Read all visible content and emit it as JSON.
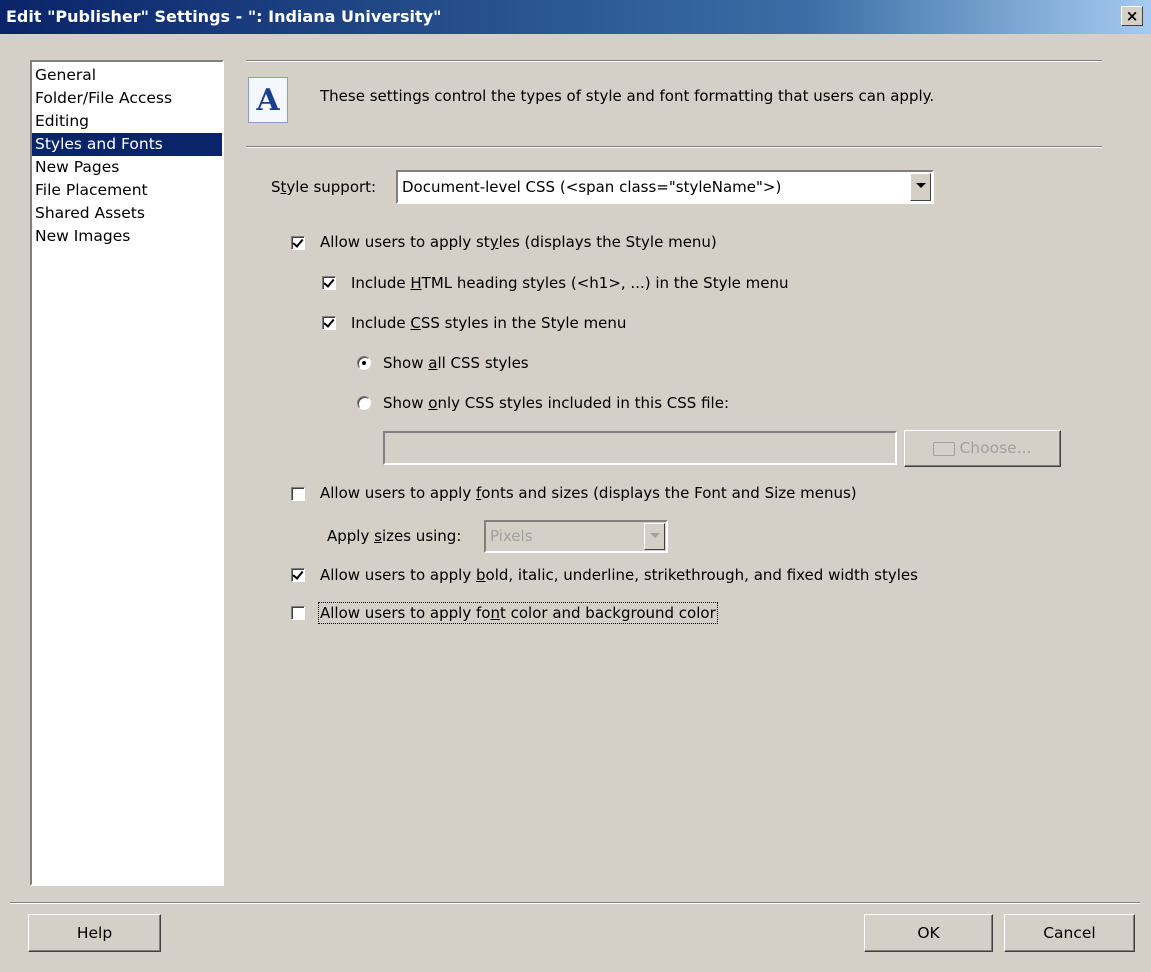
{
  "window": {
    "title": "Edit \"Publisher\" Settings - \": Indiana University\"",
    "close_label": "×"
  },
  "nav": {
    "items": [
      {
        "label": "General"
      },
      {
        "label": "Folder/File Access"
      },
      {
        "label": "Editing"
      },
      {
        "label": "Styles and Fonts",
        "selected": true
      },
      {
        "label": "New Pages"
      },
      {
        "label": "File Placement"
      },
      {
        "label": "Shared Assets"
      },
      {
        "label": "New Images"
      }
    ]
  },
  "header": {
    "icon": "font-a-icon",
    "icon_glyph": "A",
    "description": "These settings control the types of style and font formatting that users can apply."
  },
  "style_support": {
    "label_prefix": "S",
    "label_u": "t",
    "label_rest": "yle support:",
    "value": "Document-level CSS (<span class=\"styleName\">)"
  },
  "allow_styles": {
    "checked": true,
    "pre": "Allow users to apply st",
    "u": "y",
    "post": "les (displays the Style menu)"
  },
  "include_html": {
    "checked": true,
    "pre": "Include ",
    "u": "H",
    "post": "TML heading styles (<h1>, ...) in the Style menu"
  },
  "include_css": {
    "checked": true,
    "pre": "Include ",
    "u": "C",
    "post": "SS styles in the Style menu"
  },
  "show_all": {
    "selected": true,
    "pre": "Show ",
    "u": "a",
    "post": "ll CSS styles"
  },
  "show_only": {
    "selected": false,
    "pre": "Show ",
    "u": "o",
    "post": "nly CSS styles included in this CSS file:"
  },
  "css_file": {
    "value": ""
  },
  "choose_button": {
    "label": "Choose...",
    "icon": "folder-icon"
  },
  "allow_fonts": {
    "checked": false,
    "pre": "Allow users to apply ",
    "u": "f",
    "post": "onts and sizes (displays the Font and Size menus)"
  },
  "apply_sizes": {
    "pre": "Apply ",
    "u": "s",
    "post": "izes using:",
    "value": "Pixels"
  },
  "allow_bold": {
    "checked": true,
    "pre": "Allow users to apply ",
    "u": "b",
    "post": "old, italic, underline, strikethrough, and fixed width styles"
  },
  "allow_color": {
    "checked": false,
    "pre": "Allow users to apply fo",
    "u": "n",
    "post": "t color and background color"
  },
  "footer": {
    "help": "Help",
    "ok": "OK",
    "cancel": "Cancel"
  }
}
